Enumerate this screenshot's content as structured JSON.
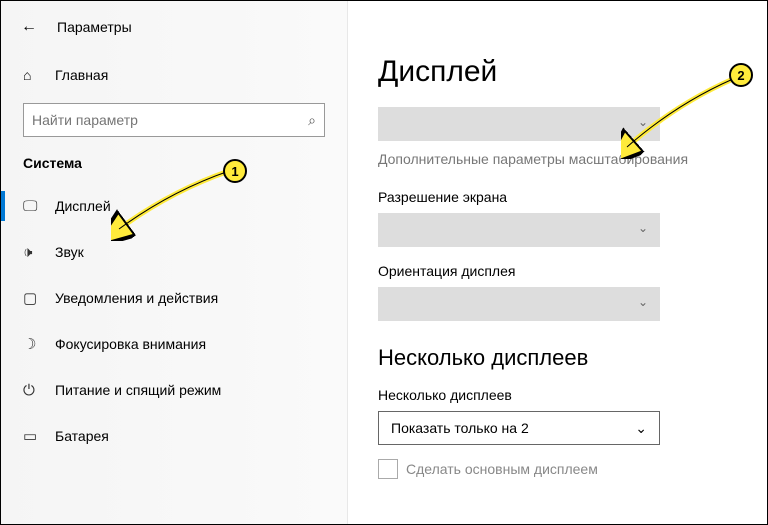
{
  "header": {
    "title": "Параметры"
  },
  "sidebar": {
    "home": "Главная",
    "search_placeholder": "Найти параметр",
    "section": "Система",
    "items": [
      {
        "label": "Дисплей"
      },
      {
        "label": "Звук"
      },
      {
        "label": "Уведомления и действия"
      },
      {
        "label": "Фокусировка внимания"
      },
      {
        "label": "Питание и спящий режим"
      },
      {
        "label": "Батарея"
      }
    ]
  },
  "main": {
    "title": "Дисплей",
    "scaling_link": "Дополнительные параметры масштабирования",
    "resolution_label": "Разрешение экрана",
    "orientation_label": "Ориентация дисплея",
    "multiple_heading": "Несколько дисплеев",
    "multiple_label": "Несколько дисплеев",
    "multiple_value": "Показать только на 2",
    "primary_checkbox": "Сделать основным дисплеем"
  },
  "callouts": {
    "one": "1",
    "two": "2"
  }
}
